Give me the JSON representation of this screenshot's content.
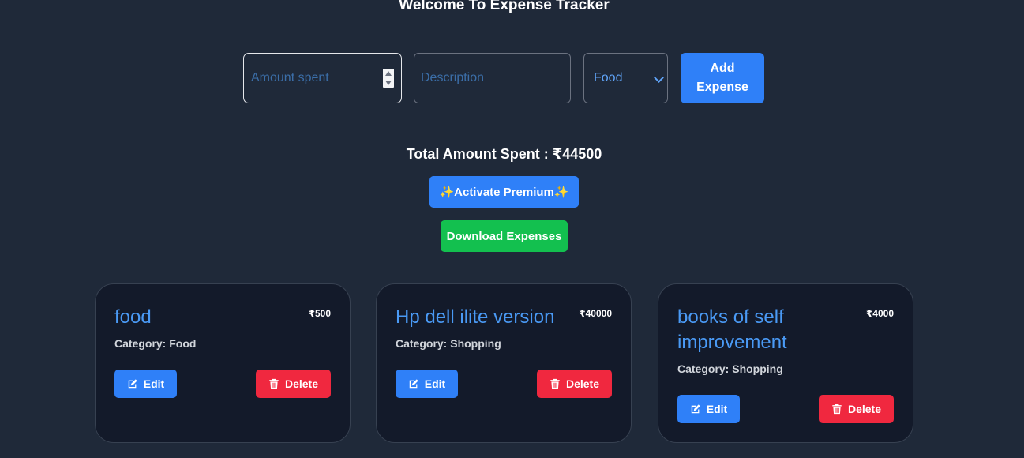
{
  "header": {
    "title": "Welcome To Expense Tracker"
  },
  "form": {
    "amount_placeholder": "Amount spent",
    "description_placeholder": "Description",
    "category_selected": "Food",
    "add_label_line1": "Add",
    "add_label_line2": "Expense"
  },
  "summary": {
    "total_label": "Total Amount Spent : ₹44500",
    "premium_label": "Activate Premium",
    "premium_spark": "✨",
    "download_label": "Download Expenses"
  },
  "expenses": [
    {
      "title": "food",
      "amount": "₹500",
      "category": "Category: Food",
      "edit_label": "Edit",
      "delete_label": "Delete"
    },
    {
      "title": "Hp dell ilite version",
      "amount": "₹40000",
      "category": "Category: Shopping",
      "edit_label": "Edit",
      "delete_label": "Delete"
    },
    {
      "title": "books of self improvement",
      "amount": "₹4000",
      "category": "Category: Shopping",
      "edit_label": "Edit",
      "delete_label": "Delete"
    }
  ],
  "colors": {
    "background": "#1f2939",
    "card": "#131a2a",
    "primary": "#2f80f8",
    "success": "#13c04f",
    "danger": "#f0283f",
    "accent_text": "#4a9af5"
  },
  "icons": {
    "edit": "edit-icon",
    "delete": "trash-icon",
    "spinner": "number-spinner-icon",
    "dropdown": "chevron-down-icon"
  }
}
